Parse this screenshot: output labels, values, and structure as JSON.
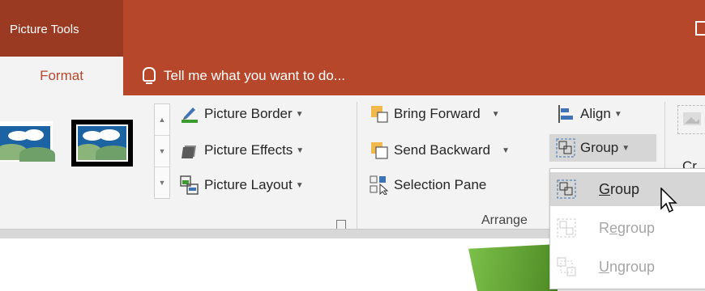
{
  "titlebar": {
    "context_tab": "Picture Tools"
  },
  "tabs": {
    "format": "Format",
    "tell_me": "Tell me what you want to do..."
  },
  "picture_styles": {
    "border": "Picture Border",
    "effects": "Picture Effects",
    "layout": "Picture Layout"
  },
  "arrange": {
    "bring_forward": "Bring Forward",
    "send_backward": "Send Backward",
    "selection_pane": "Selection Pane",
    "align": "Align",
    "group": "Group",
    "group_label": "Arrange",
    "partial_right": "Cr"
  },
  "group_menu": {
    "items": [
      {
        "label": "Group",
        "underline": "G",
        "rest": "roup",
        "state": "active"
      },
      {
        "label": "Regroup",
        "underline": "e",
        "prefix": "R",
        "rest": "group",
        "state": "disabled"
      },
      {
        "label": "Ungroup",
        "underline": "U",
        "rest": "ngroup",
        "state": "disabled"
      }
    ]
  },
  "colors": {
    "accent": "#b7472a",
    "context": "#9b3a22",
    "ribbon": "#f3f3f3",
    "hover": "#d6d6d6"
  }
}
